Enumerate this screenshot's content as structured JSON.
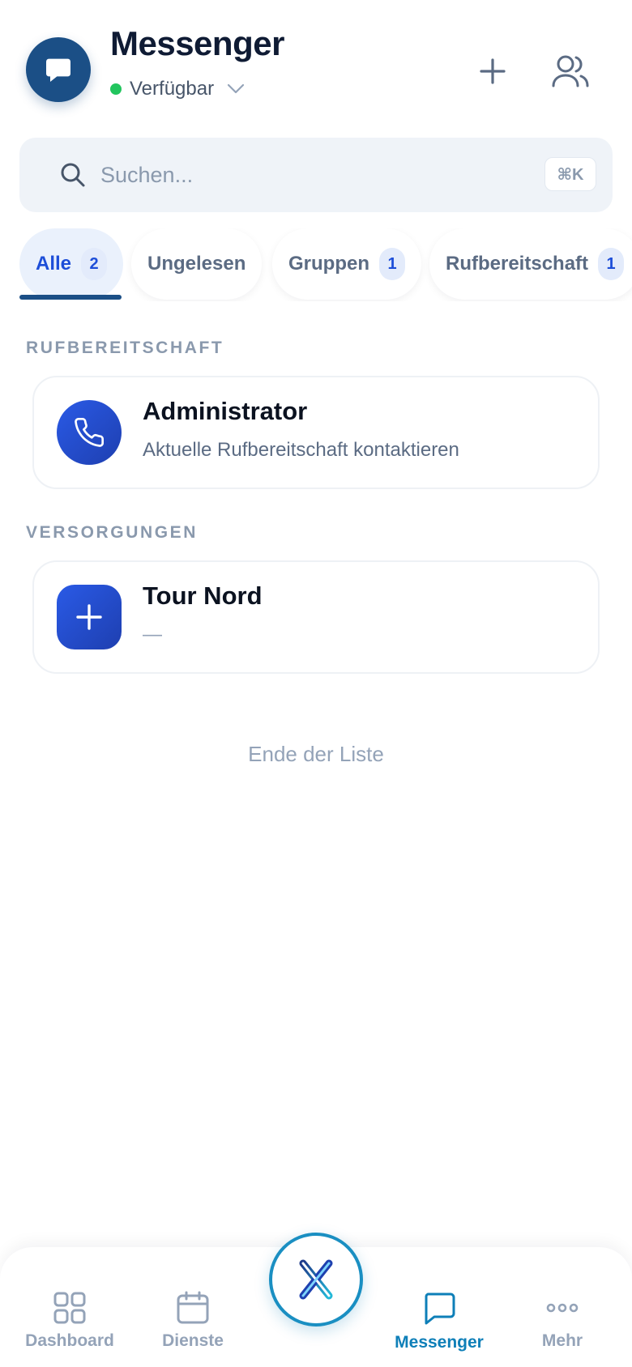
{
  "header": {
    "title": "Messenger",
    "status_label": "Verfügbar",
    "status_color": "#22c55e",
    "new_chat_icon": "plus-icon",
    "contacts_icon": "users-icon",
    "avatar_icon": "chat-bubble-icon"
  },
  "search": {
    "placeholder": "Suchen...",
    "value": "",
    "shortcut": "⌘K"
  },
  "tabs": [
    {
      "label": "Alle",
      "count": "2",
      "active": true
    },
    {
      "label": "Ungelesen",
      "count": "",
      "active": false
    },
    {
      "label": "Gruppen",
      "count": "1",
      "active": false
    },
    {
      "label": "Rufbereitschaft",
      "count": "1",
      "active": false
    }
  ],
  "sections": [
    {
      "title": "RUFBEREITSCHAFT",
      "items": [
        {
          "title": "Administrator",
          "subtitle": "Aktuelle Rufbereitschaft kontaktieren",
          "icon": "phone-icon"
        }
      ]
    },
    {
      "title": "VERSORGUNGEN",
      "items": [
        {
          "title": "Tour Nord",
          "subtitle": "—",
          "icon": "plus-icon"
        }
      ]
    }
  ],
  "end_of_list": "Ende der Liste",
  "nav": {
    "items": [
      {
        "label": "Dashboard",
        "icon": "grid-icon",
        "active": false
      },
      {
        "label": "Dienste",
        "icon": "calendar-icon",
        "active": false
      },
      {
        "label": "Messenger",
        "icon": "chat-icon",
        "active": true
      },
      {
        "label": "Mehr",
        "icon": "more-dots-icon",
        "active": false
      }
    ],
    "center_icon": "app-logo-icon"
  },
  "colors": {
    "brand_dark": "#1b4f86",
    "accent_blue": "#1d4ed8",
    "nav_active": "#0e7fb8"
  }
}
